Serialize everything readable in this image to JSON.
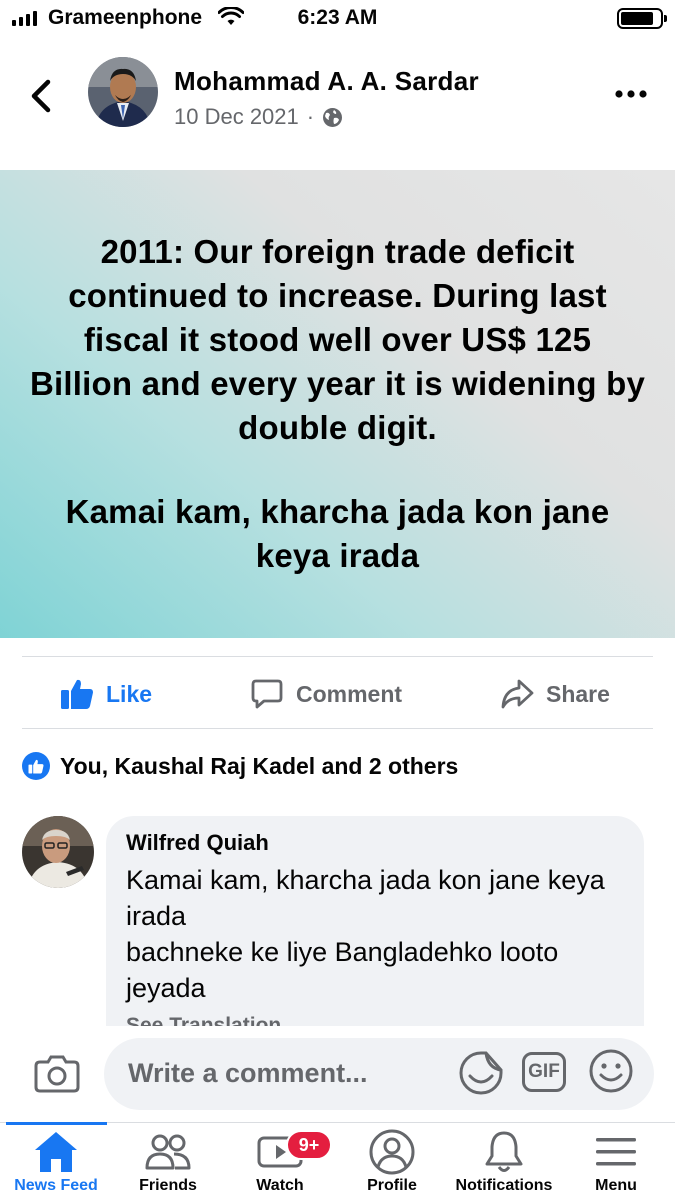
{
  "status_bar": {
    "carrier": "Grameenphone",
    "time": "6:23 AM"
  },
  "post": {
    "author": "Mohammad A. A. Sardar",
    "date": "10 Dec 2021",
    "separator": "·",
    "audience_icon": "globe-icon",
    "image_text_1": "2011: Our foreign trade deficit continued to increase. During last fiscal it stood well over US$ 125 Billion and every year it is widening by double digit.",
    "image_text_2": "Kamai kam, kharcha jada kon jane keya irada"
  },
  "actions": {
    "like": "Like",
    "comment": "Comment",
    "share": "Share"
  },
  "reactions": {
    "summary": "You, Kaushal Raj Kadel and 2 others"
  },
  "comment": {
    "author": "Wilfred Quiah",
    "text_1": "Kamai kam, kharcha jada kon jane keya irada",
    "text_2": "bachneke ke liye Bangladehko looto jeyada",
    "see_translation": "See Translation"
  },
  "composer": {
    "placeholder": "Write a comment...",
    "gif_label": "GIF"
  },
  "tabs": [
    {
      "label": "News Feed",
      "icon": "home-icon",
      "active": true
    },
    {
      "label": "Friends",
      "icon": "friends-icon"
    },
    {
      "label": "Watch",
      "icon": "watch-icon",
      "badge": "9+"
    },
    {
      "label": "Profile",
      "icon": "profile-icon"
    },
    {
      "label": "Notifications",
      "icon": "bell-icon"
    },
    {
      "label": "Menu",
      "icon": "menu-icon"
    }
  ],
  "colors": {
    "accent": "#1877f2",
    "badge": "#e41e3f",
    "secondary_text": "#65676b"
  }
}
